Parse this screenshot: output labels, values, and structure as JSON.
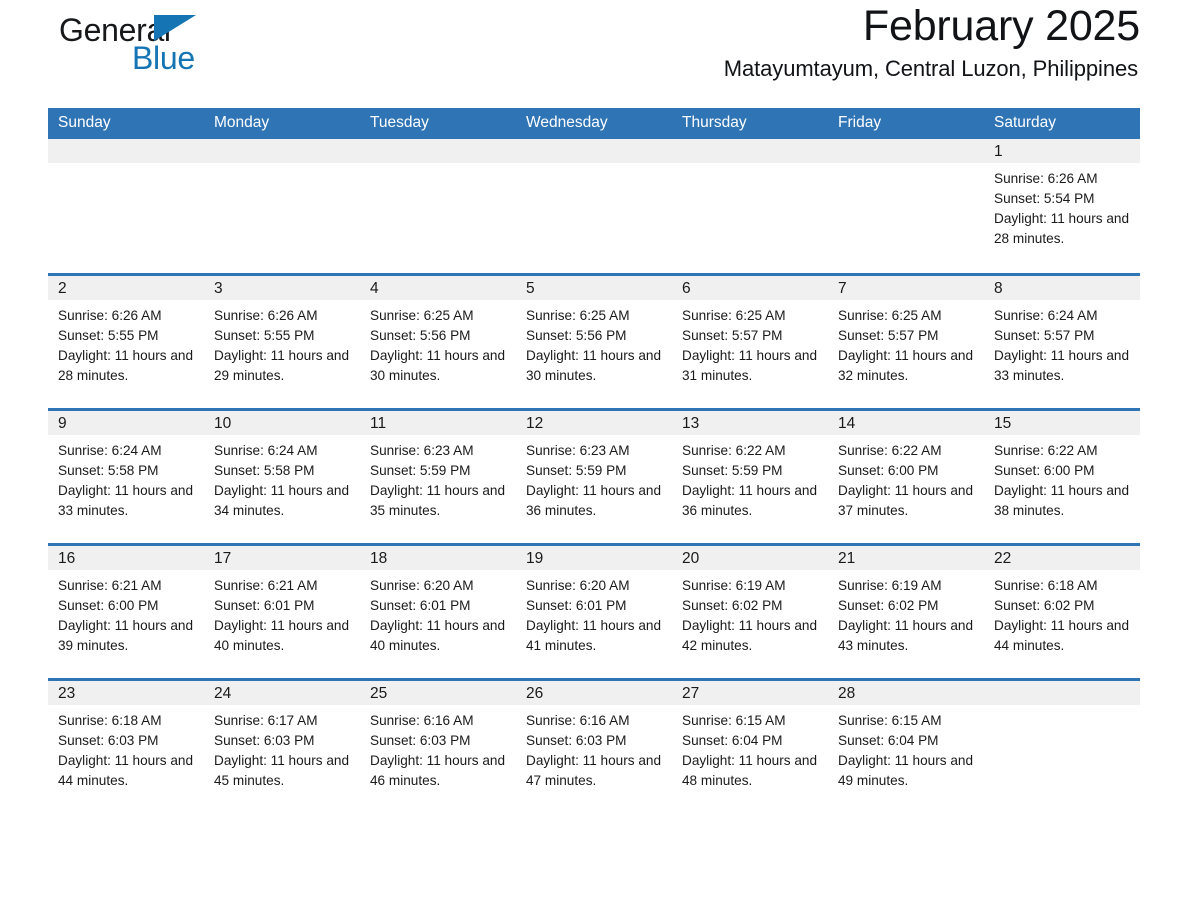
{
  "brand": {
    "word_one": "General",
    "word_two": "Blue",
    "triangle_icon": "triangle-logo-icon",
    "accent_color": "#1474b4"
  },
  "header": {
    "title": "February 2025",
    "subtitle": "Matayumtayum, Central Luzon, Philippines"
  },
  "theme": {
    "header_blue": "#2f74b5",
    "day_strip_gray": "#f0f0f0",
    "text": "#1a1a1a"
  },
  "weekday_headers": [
    "Sunday",
    "Monday",
    "Tuesday",
    "Wednesday",
    "Thursday",
    "Friday",
    "Saturday"
  ],
  "labels": {
    "sunrise_prefix": "Sunrise: ",
    "sunset_prefix": "Sunset: ",
    "daylight_prefix": "Daylight: "
  },
  "weeks": [
    [
      {
        "empty": true
      },
      {
        "empty": true
      },
      {
        "empty": true
      },
      {
        "empty": true
      },
      {
        "empty": true
      },
      {
        "empty": true
      },
      {
        "day": "1",
        "sunrise": "Sunrise: 6:26 AM",
        "sunset": "Sunset: 5:54 PM",
        "daylight": "Daylight: 11 hours and 28 minutes."
      }
    ],
    [
      {
        "day": "2",
        "sunrise": "Sunrise: 6:26 AM",
        "sunset": "Sunset: 5:55 PM",
        "daylight": "Daylight: 11 hours and 28 minutes."
      },
      {
        "day": "3",
        "sunrise": "Sunrise: 6:26 AM",
        "sunset": "Sunset: 5:55 PM",
        "daylight": "Daylight: 11 hours and 29 minutes."
      },
      {
        "day": "4",
        "sunrise": "Sunrise: 6:25 AM",
        "sunset": "Sunset: 5:56 PM",
        "daylight": "Daylight: 11 hours and 30 minutes."
      },
      {
        "day": "5",
        "sunrise": "Sunrise: 6:25 AM",
        "sunset": "Sunset: 5:56 PM",
        "daylight": "Daylight: 11 hours and 30 minutes."
      },
      {
        "day": "6",
        "sunrise": "Sunrise: 6:25 AM",
        "sunset": "Sunset: 5:57 PM",
        "daylight": "Daylight: 11 hours and 31 minutes."
      },
      {
        "day": "7",
        "sunrise": "Sunrise: 6:25 AM",
        "sunset": "Sunset: 5:57 PM",
        "daylight": "Daylight: 11 hours and 32 minutes."
      },
      {
        "day": "8",
        "sunrise": "Sunrise: 6:24 AM",
        "sunset": "Sunset: 5:57 PM",
        "daylight": "Daylight: 11 hours and 33 minutes."
      }
    ],
    [
      {
        "day": "9",
        "sunrise": "Sunrise: 6:24 AM",
        "sunset": "Sunset: 5:58 PM",
        "daylight": "Daylight: 11 hours and 33 minutes."
      },
      {
        "day": "10",
        "sunrise": "Sunrise: 6:24 AM",
        "sunset": "Sunset: 5:58 PM",
        "daylight": "Daylight: 11 hours and 34 minutes."
      },
      {
        "day": "11",
        "sunrise": "Sunrise: 6:23 AM",
        "sunset": "Sunset: 5:59 PM",
        "daylight": "Daylight: 11 hours and 35 minutes."
      },
      {
        "day": "12",
        "sunrise": "Sunrise: 6:23 AM",
        "sunset": "Sunset: 5:59 PM",
        "daylight": "Daylight: 11 hours and 36 minutes."
      },
      {
        "day": "13",
        "sunrise": "Sunrise: 6:22 AM",
        "sunset": "Sunset: 5:59 PM",
        "daylight": "Daylight: 11 hours and 36 minutes."
      },
      {
        "day": "14",
        "sunrise": "Sunrise: 6:22 AM",
        "sunset": "Sunset: 6:00 PM",
        "daylight": "Daylight: 11 hours and 37 minutes."
      },
      {
        "day": "15",
        "sunrise": "Sunrise: 6:22 AM",
        "sunset": "Sunset: 6:00 PM",
        "daylight": "Daylight: 11 hours and 38 minutes."
      }
    ],
    [
      {
        "day": "16",
        "sunrise": "Sunrise: 6:21 AM",
        "sunset": "Sunset: 6:00 PM",
        "daylight": "Daylight: 11 hours and 39 minutes."
      },
      {
        "day": "17",
        "sunrise": "Sunrise: 6:21 AM",
        "sunset": "Sunset: 6:01 PM",
        "daylight": "Daylight: 11 hours and 40 minutes."
      },
      {
        "day": "18",
        "sunrise": "Sunrise: 6:20 AM",
        "sunset": "Sunset: 6:01 PM",
        "daylight": "Daylight: 11 hours and 40 minutes."
      },
      {
        "day": "19",
        "sunrise": "Sunrise: 6:20 AM",
        "sunset": "Sunset: 6:01 PM",
        "daylight": "Daylight: 11 hours and 41 minutes."
      },
      {
        "day": "20",
        "sunrise": "Sunrise: 6:19 AM",
        "sunset": "Sunset: 6:02 PM",
        "daylight": "Daylight: 11 hours and 42 minutes."
      },
      {
        "day": "21",
        "sunrise": "Sunrise: 6:19 AM",
        "sunset": "Sunset: 6:02 PM",
        "daylight": "Daylight: 11 hours and 43 minutes."
      },
      {
        "day": "22",
        "sunrise": "Sunrise: 6:18 AM",
        "sunset": "Sunset: 6:02 PM",
        "daylight": "Daylight: 11 hours and 44 minutes."
      }
    ],
    [
      {
        "day": "23",
        "sunrise": "Sunrise: 6:18 AM",
        "sunset": "Sunset: 6:03 PM",
        "daylight": "Daylight: 11 hours and 44 minutes."
      },
      {
        "day": "24",
        "sunrise": "Sunrise: 6:17 AM",
        "sunset": "Sunset: 6:03 PM",
        "daylight": "Daylight: 11 hours and 45 minutes."
      },
      {
        "day": "25",
        "sunrise": "Sunrise: 6:16 AM",
        "sunset": "Sunset: 6:03 PM",
        "daylight": "Daylight: 11 hours and 46 minutes."
      },
      {
        "day": "26",
        "sunrise": "Sunrise: 6:16 AM",
        "sunset": "Sunset: 6:03 PM",
        "daylight": "Daylight: 11 hours and 47 minutes."
      },
      {
        "day": "27",
        "sunrise": "Sunrise: 6:15 AM",
        "sunset": "Sunset: 6:04 PM",
        "daylight": "Daylight: 11 hours and 48 minutes."
      },
      {
        "day": "28",
        "sunrise": "Sunrise: 6:15 AM",
        "sunset": "Sunset: 6:04 PM",
        "daylight": "Daylight: 11 hours and 49 minutes."
      },
      {
        "empty": true
      }
    ]
  ]
}
